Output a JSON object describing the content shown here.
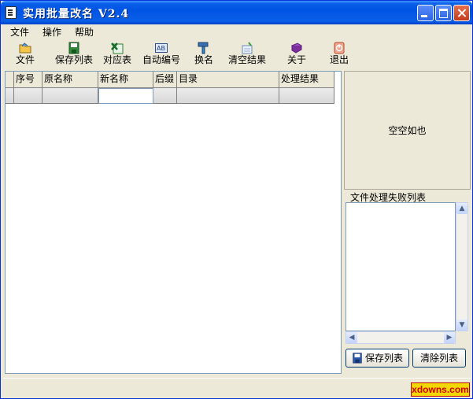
{
  "window": {
    "title": "实用批量改名 V2.4",
    "title_color": "#0054e3"
  },
  "menu": [
    {
      "label": "文件"
    },
    {
      "label": "操作"
    },
    {
      "label": "帮助"
    }
  ],
  "toolbar": [
    {
      "label": "文件",
      "icon": "folder-icon"
    },
    {
      "label": "保存列表",
      "icon": "floppy-disk-icon"
    },
    {
      "label": "对应表",
      "icon": "excel-icon"
    },
    {
      "label": "自动编号",
      "icon": "ab-numbering-icon"
    },
    {
      "label": "换名",
      "icon": "hammer-icon"
    },
    {
      "label": "清空结果",
      "icon": "broom-icon"
    },
    {
      "label": "关于",
      "icon": "book-icon"
    },
    {
      "label": "退出",
      "icon": "exit-icon"
    }
  ],
  "grid": {
    "columns": [
      "",
      "序号",
      "原名称",
      "新名称",
      "后缀",
      "目录",
      "处理结果"
    ]
  },
  "preview": {
    "text": "空空如也"
  },
  "fail_list": {
    "label": "文件处理失败列表"
  },
  "buttons": {
    "save_list": "保存列表",
    "clear_list": "清除列表"
  },
  "watermark": "xdowns.com"
}
